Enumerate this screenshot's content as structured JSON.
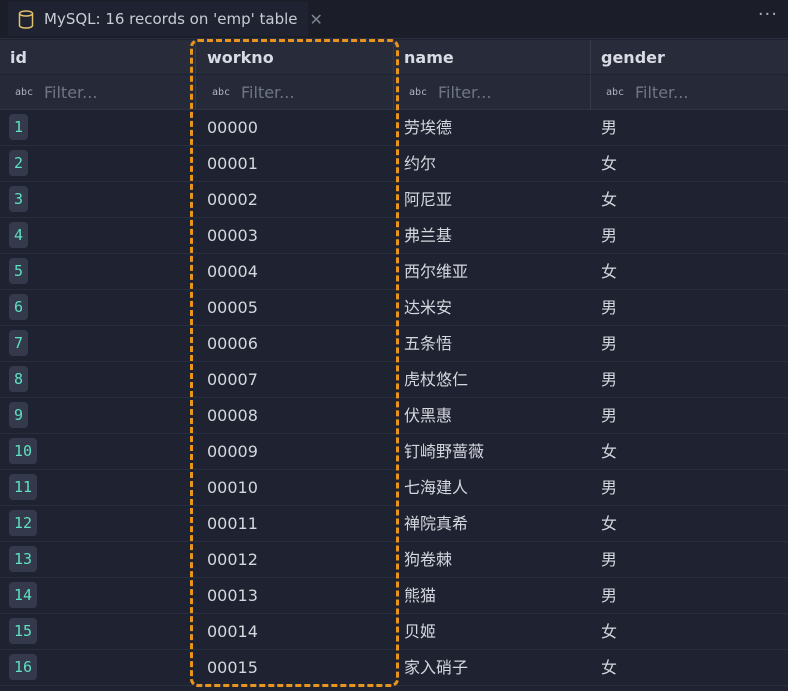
{
  "tab": {
    "title": "MySQL: 16 records on 'emp' table",
    "close_label": "✕",
    "more_label": "···"
  },
  "columns": [
    {
      "key": "id",
      "label": "id"
    },
    {
      "key": "workno",
      "label": "workno"
    },
    {
      "key": "name",
      "label": "name"
    },
    {
      "key": "gender",
      "label": "gender"
    }
  ],
  "filter": {
    "placeholder": "Filter...",
    "type_label": "abc"
  },
  "rows": [
    {
      "id": "1",
      "workno": "00000",
      "name": "劳埃德",
      "gender": "男"
    },
    {
      "id": "2",
      "workno": "00001",
      "name": "约尔",
      "gender": "女"
    },
    {
      "id": "3",
      "workno": "00002",
      "name": "阿尼亚",
      "gender": "女"
    },
    {
      "id": "4",
      "workno": "00003",
      "name": "弗兰基",
      "gender": "男"
    },
    {
      "id": "5",
      "workno": "00004",
      "name": "西尔维亚",
      "gender": "女"
    },
    {
      "id": "6",
      "workno": "00005",
      "name": "达米安",
      "gender": "男"
    },
    {
      "id": "7",
      "workno": "00006",
      "name": "五条悟",
      "gender": "男"
    },
    {
      "id": "8",
      "workno": "00007",
      "name": "虎杖悠仁",
      "gender": "男"
    },
    {
      "id": "9",
      "workno": "00008",
      "name": "伏黑惠",
      "gender": "男"
    },
    {
      "id": "10",
      "workno": "00009",
      "name": "钉崎野蔷薇",
      "gender": "女"
    },
    {
      "id": "11",
      "workno": "00010",
      "name": "七海建人",
      "gender": "男"
    },
    {
      "id": "12",
      "workno": "00011",
      "name": "禅院真希",
      "gender": "女"
    },
    {
      "id": "13",
      "workno": "00012",
      "name": "狗卷棘",
      "gender": "男"
    },
    {
      "id": "14",
      "workno": "00013",
      "name": "熊猫",
      "gender": "男"
    },
    {
      "id": "15",
      "workno": "00014",
      "name": "贝姬",
      "gender": "女"
    },
    {
      "id": "16",
      "workno": "00015",
      "name": "家入硝子",
      "gender": "女"
    }
  ],
  "colors": {
    "highlight": "#e8951f",
    "id_badge_text": "#5ee0c1",
    "background": "#1f2230"
  }
}
